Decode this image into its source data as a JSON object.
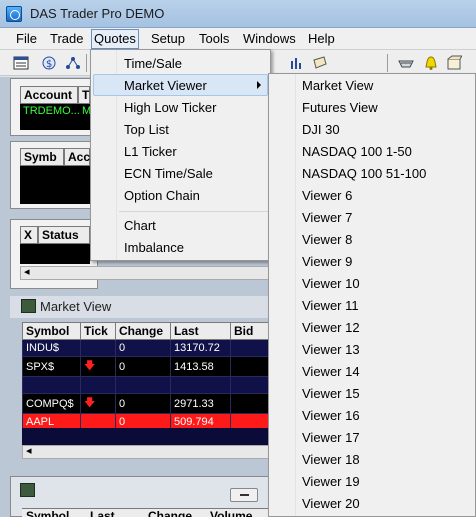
{
  "window": {
    "title": "DAS Trader Pro DEMO"
  },
  "menubar": {
    "items": [
      "File",
      "Trade",
      "Quotes",
      "Setup",
      "Tools",
      "Windows",
      "Help"
    ]
  },
  "account_panel": {
    "headers": [
      "Account",
      "T"
    ],
    "row": [
      "TRDEMO...",
      "M"
    ]
  },
  "position_panel": {
    "headers": [
      "Symb",
      "Acc"
    ]
  },
  "order_panel": {
    "headers": [
      "X",
      "Status"
    ]
  },
  "market_view": {
    "title": "Market View",
    "columns": [
      "Symbol",
      "Tick",
      "Change",
      "Last",
      "Bid"
    ],
    "rows": [
      {
        "symbol": "INDU$",
        "tick": "",
        "change": "0",
        "last": "13170.72",
        "bid": ""
      },
      {
        "symbol": "SPX$",
        "tick": "down",
        "change": "0",
        "last": "1413.58",
        "bid": ""
      },
      {
        "symbol": "",
        "tick": "",
        "change": "",
        "last": "",
        "bid": ""
      },
      {
        "symbol": "COMPQ$",
        "tick": "down",
        "change": "0",
        "last": "2971.33",
        "bid": ""
      },
      {
        "symbol": "AAPL",
        "tick": "",
        "change": "0",
        "last": "509.794",
        "bid": ""
      }
    ]
  },
  "bottom_panel": {
    "columns": [
      "Symbol",
      "Last",
      "Change",
      "Volume"
    ]
  },
  "quotes_menu": {
    "items": [
      "Time/Sale",
      "Market Viewer",
      "High Low Ticker",
      "Top List",
      "L1 Ticker",
      "ECN Time/Sale",
      "Option Chain",
      "Chart",
      "Imbalance"
    ],
    "highlighted": "Market Viewer"
  },
  "market_viewer_submenu": {
    "items": [
      "Market View",
      "Futures View",
      "DJI 30",
      "NASDAQ 100 1-50",
      "NASDAQ 100 51-100",
      "Viewer 6",
      "Viewer 7",
      "Viewer 8",
      "Viewer 9",
      "Viewer 10",
      "Viewer 11",
      "Viewer 12",
      "Viewer 13",
      "Viewer 14",
      "Viewer 15",
      "Viewer 16",
      "Viewer 17",
      "Viewer 18",
      "Viewer 19",
      "Viewer 20"
    ]
  },
  "colors": {
    "row_navy": "#11114a",
    "row_red": "#ff1a1a",
    "menu_highlight": "#d8e6f6",
    "account_text_green": "#39ff39"
  }
}
